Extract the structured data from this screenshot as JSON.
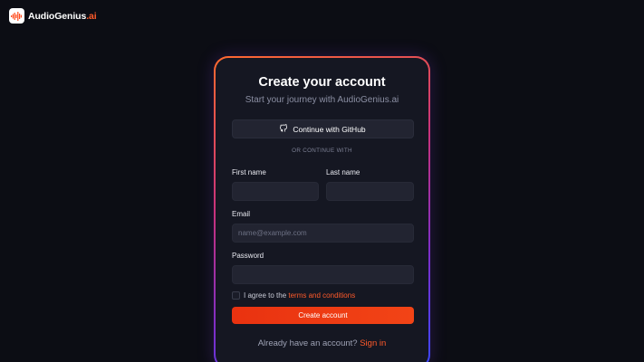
{
  "brand": {
    "logo_icon": "waveform-icon",
    "name": "AudioGenius",
    "tld": ".ai",
    "accent_color": "#ff5a2a"
  },
  "card": {
    "title": "Create your account",
    "subtitle": "Start your journey with AudioGenius.ai",
    "github_button": {
      "icon": "github-icon",
      "label": "Continue with GitHub"
    },
    "divider": "OR CONTINUE WITH",
    "fields": {
      "first_name": {
        "label": "First name",
        "value": "",
        "placeholder": ""
      },
      "last_name": {
        "label": "Last name",
        "value": "",
        "placeholder": ""
      },
      "email": {
        "label": "Email",
        "value": "",
        "placeholder": "name@example.com"
      },
      "password": {
        "label": "Password",
        "value": "",
        "placeholder": ""
      }
    },
    "terms": {
      "checked": false,
      "prefix": "I agree to the ",
      "link": "terms and conditions"
    },
    "submit_label": "Create account",
    "footer": {
      "prompt": "Already have an account? ",
      "link": "Sign in"
    }
  }
}
